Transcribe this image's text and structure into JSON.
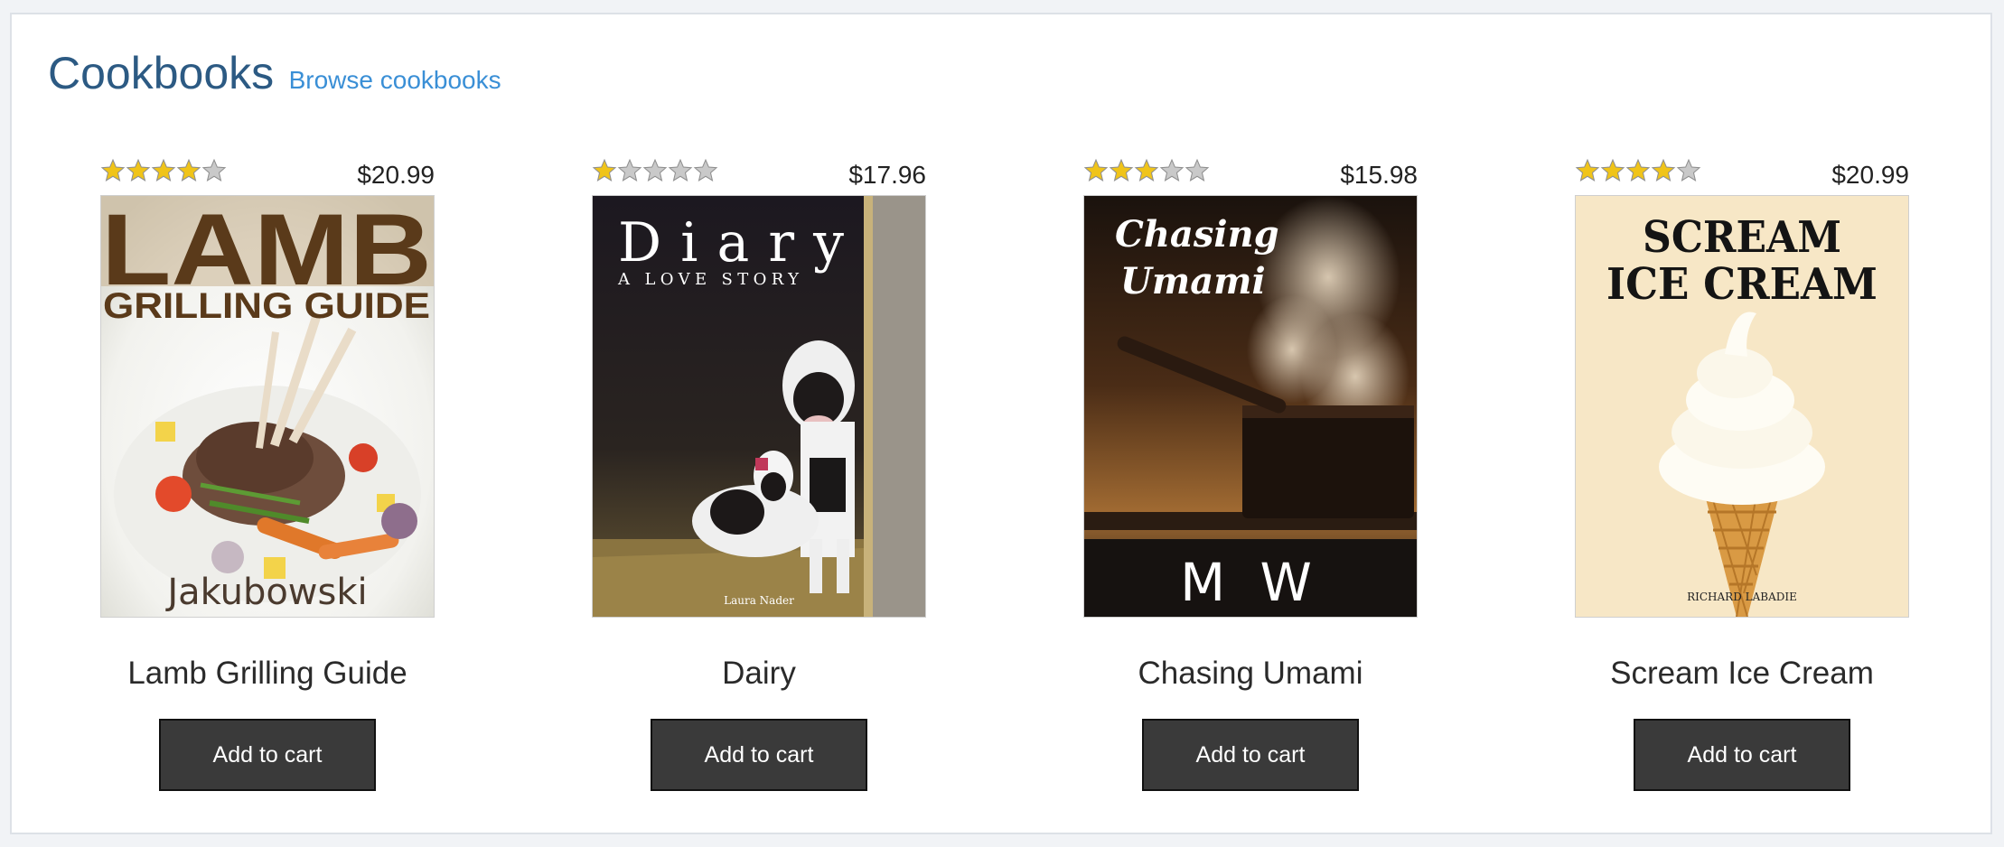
{
  "section": {
    "title": "Cookbooks",
    "browse_link": "Browse cookbooks"
  },
  "colors": {
    "title": "#2c5a83",
    "link": "#3a8fd6",
    "button_bg": "#3a3a3a",
    "star_filled": "#f0c419",
    "star_empty": "#c9c9c9"
  },
  "products": [
    {
      "title": "Lamb Grilling Guide",
      "price": "$20.99",
      "rating": 4,
      "rating_max": 5,
      "button_label": "Add to cart",
      "cover": {
        "line1": "LAMB",
        "line2": "GRILLING GUIDE",
        "author": "Jakubowski"
      }
    },
    {
      "title": "Dairy",
      "price": "$17.96",
      "rating": 1,
      "rating_max": 5,
      "button_label": "Add to cart",
      "cover": {
        "line1": "Diary",
        "line2": "A LOVE STORY",
        "author": "Laura Nader"
      }
    },
    {
      "title": "Chasing Umami",
      "price": "$15.98",
      "rating": 3,
      "rating_max": 5,
      "button_label": "Add to cart",
      "cover": {
        "line1": "Chasing",
        "line2": "Umami",
        "author": "M W"
      }
    },
    {
      "title": "Scream Ice Cream",
      "price": "$20.99",
      "rating": 4,
      "rating_max": 5,
      "button_label": "Add to cart",
      "cover": {
        "line1": "SCREAM",
        "line2": "ICE CREAM",
        "author": "RICHARD LABADIE"
      }
    }
  ]
}
